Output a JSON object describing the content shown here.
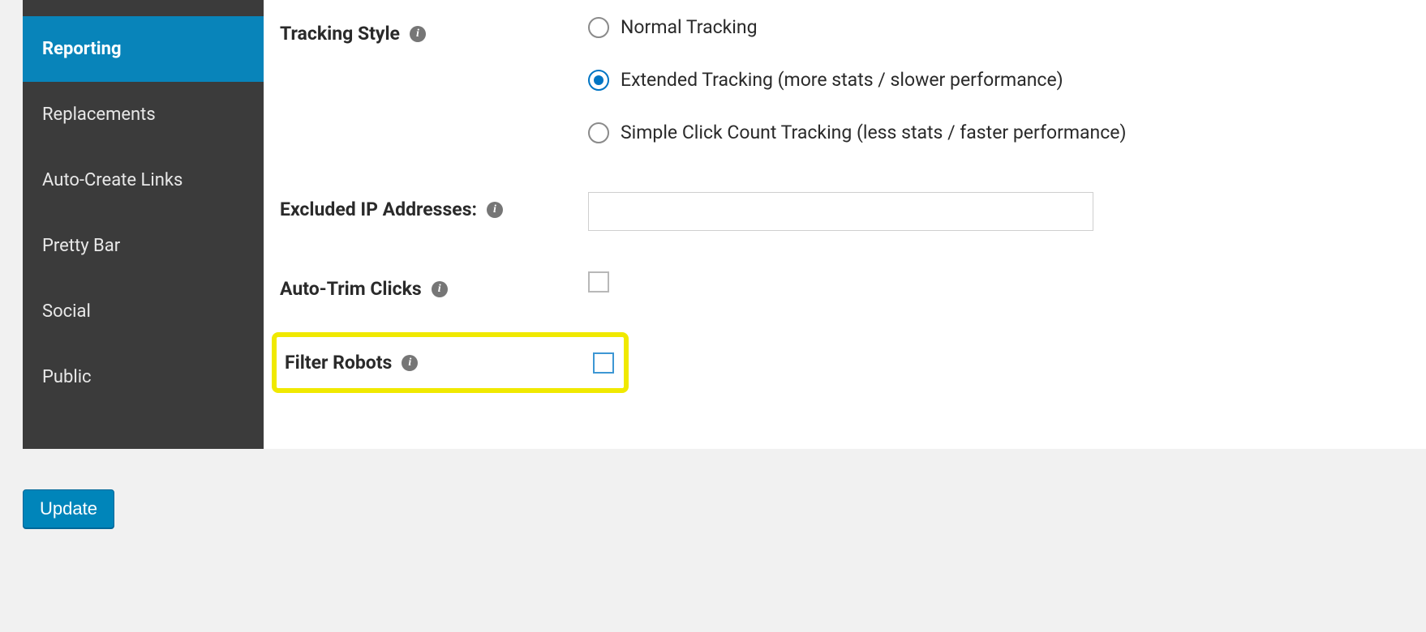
{
  "sidebar": {
    "items": [
      {
        "label": "Reporting",
        "active": true
      },
      {
        "label": "Replacements",
        "active": false
      },
      {
        "label": "Auto-Create Links",
        "active": false
      },
      {
        "label": "Pretty Bar",
        "active": false
      },
      {
        "label": "Social",
        "active": false
      },
      {
        "label": "Public",
        "active": false
      }
    ]
  },
  "settings": {
    "tracking_style": {
      "label": "Tracking Style",
      "options": [
        {
          "label": "Normal Tracking",
          "checked": false
        },
        {
          "label": "Extended Tracking (more stats / slower performance)",
          "checked": true
        },
        {
          "label": "Simple Click Count Tracking (less stats / faster performance)",
          "checked": false
        }
      ]
    },
    "excluded_ips": {
      "label": "Excluded IP Addresses:",
      "value": ""
    },
    "auto_trim": {
      "label": "Auto-Trim Clicks",
      "checked": false
    },
    "filter_robots": {
      "label": "Filter Robots",
      "checked": false
    }
  },
  "buttons": {
    "update": "Update"
  }
}
